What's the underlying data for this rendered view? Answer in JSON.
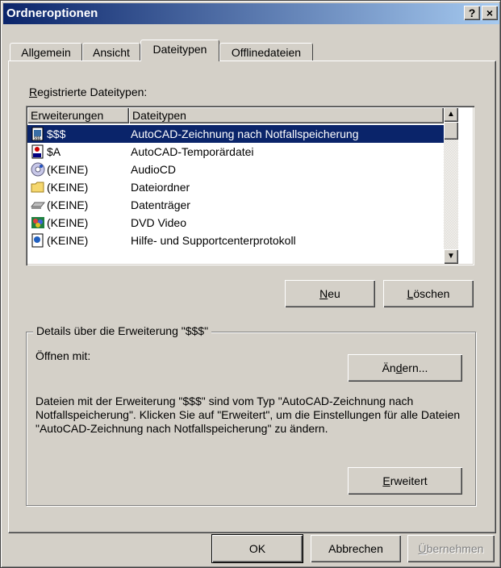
{
  "window": {
    "title": "Ordneroptionen",
    "help_button": "?",
    "close_button": "×"
  },
  "tabs": [
    {
      "label": "Allgemein"
    },
    {
      "label": "Ansicht"
    },
    {
      "label": "Dateitypen"
    },
    {
      "label": "Offlinedateien"
    }
  ],
  "filetypes": {
    "label_first": "R",
    "label_rest": "egistrierte Dateitypen:",
    "columns": [
      "Erweiterungen",
      "Dateitypen"
    ],
    "rows": [
      {
        "icon": "autocad-drawing-icon",
        "ext": "$$$",
        "type": "AutoCAD-Zeichnung nach Notfallspeicherung",
        "selected": true
      },
      {
        "icon": "autocad-temp-icon",
        "ext": "$A",
        "type": "AutoCAD-Temporärdatei"
      },
      {
        "icon": "audio-cd-icon",
        "ext": "(KEINE)",
        "type": "AudioCD"
      },
      {
        "icon": "folder-icon",
        "ext": "(KEINE)",
        "type": "Dateiordner"
      },
      {
        "icon": "drive-icon",
        "ext": "(KEINE)",
        "type": "Datenträger"
      },
      {
        "icon": "dvd-video-icon",
        "ext": "(KEINE)",
        "type": "DVD Video"
      },
      {
        "icon": "help-file-icon",
        "ext": "(KEINE)",
        "type": "Hilfe- und Supportcenterprotokoll"
      }
    ]
  },
  "buttons": {
    "new_first": "N",
    "new_rest": "eu",
    "delete_first": "L",
    "delete_rest": "öschen",
    "change_pre": "Än",
    "change_ul": "d",
    "change_post": "ern...",
    "advanced_first": "E",
    "advanced_rest": "rweitert",
    "ok": "OK",
    "cancel": "Abbrechen",
    "apply_first": "Ü",
    "apply_rest": "bernehmen"
  },
  "details": {
    "legend": "Details über die Erweiterung \"$$$\"",
    "opens_with_label": "Öffnen mit:",
    "description": "Dateien mit der Erweiterung \"$$$\" sind vom Typ \"AutoCAD-Zeichnung nach Notfallspeicherung\". Klicken Sie auf \"Erweitert\", um die Einstellungen für alle Dateien \"AutoCAD-Zeichnung nach Notfallspeicherung\" zu ändern."
  },
  "colors": {
    "selection": "#0a246a",
    "face": "#d4d0c8",
    "titlebar_start": "#0a246a",
    "titlebar_end": "#a6caf0"
  }
}
